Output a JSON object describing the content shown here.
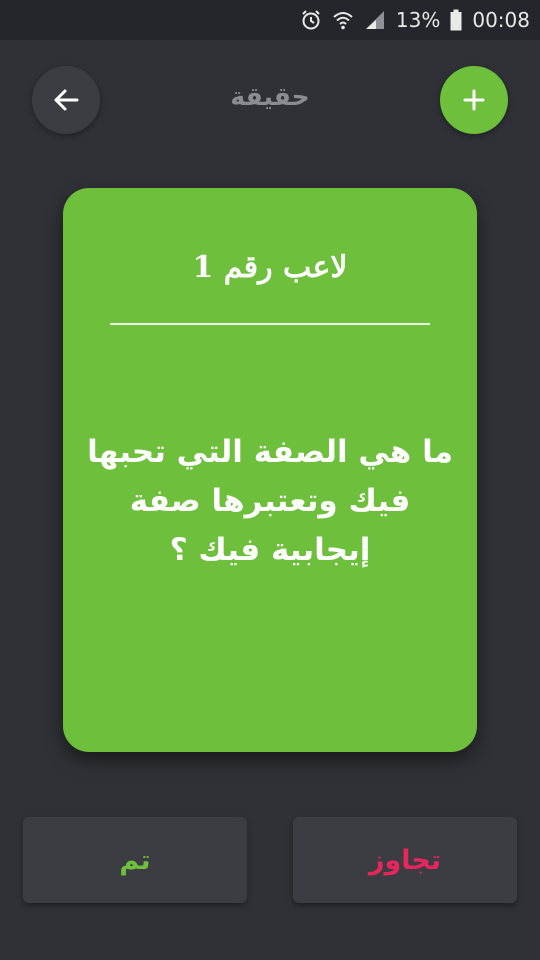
{
  "status_bar": {
    "battery_percent": "13%",
    "time": "00:08"
  },
  "header": {
    "title": "حقيقة"
  },
  "card": {
    "player_label": "لاعب رقم 1",
    "question": "ما هي الصفة التي تحبها فيك وتعتبرها صفة إيجابية فيك ؟"
  },
  "buttons": {
    "done_label": "تم",
    "skip_label": "تجاوز"
  },
  "colors": {
    "background": "#2f3136",
    "accent_green": "#6dbf3c",
    "skip_pink": "#e8255c",
    "button_gray": "#3b3d42",
    "title_gray": "#8a8c90"
  },
  "icons": {
    "back": "arrow-left-icon",
    "add": "plus-icon",
    "alarm": "alarm-clock-icon",
    "wifi": "wifi-icon",
    "signal": "signal-icon",
    "battery": "battery-icon"
  }
}
